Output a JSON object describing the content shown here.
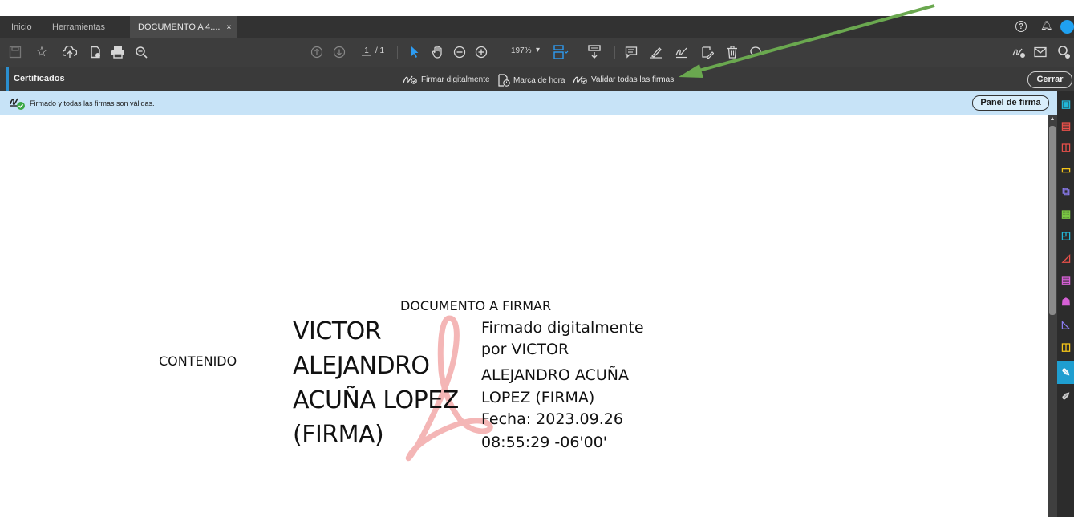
{
  "tabs": {
    "home": "Inicio",
    "tools": "Herramientas",
    "document": "DOCUMENTO A 4....",
    "close": "×"
  },
  "toolbar": {
    "page_current": "1",
    "page_total": "/ 1",
    "zoom": "197%",
    "zoom_caret": "▾"
  },
  "certificates_bar": {
    "title": "Certificados",
    "sign_digitally": "Firmar digitalmente",
    "timestamp": "Marca de hora",
    "validate_all": "Validar todas las firmas",
    "close": "Cerrar"
  },
  "signature_bar": {
    "status": "Firmado y todas las firmas son válidas.",
    "panel_button": "Panel de firma"
  },
  "document": {
    "title": "DOCUMENTO A FIRMAR",
    "content": "CONTENIDO",
    "signer_name_lines": [
      "VICTOR",
      "ALEJANDRO",
      "ACUÑA LOPEZ",
      "(FIRMA)"
    ],
    "signature_detail_lines": [
      "Firmado digitalmente",
      "por VICTOR",
      "ALEJANDRO ACUÑA",
      "LOPEZ (FIRMA)",
      "Fecha: 2023.09.26",
      "08:55:29 -06'00'"
    ]
  },
  "colors": {
    "tab_bar": "#323232",
    "toolbar": "#3d3d3d",
    "certificates_bar": "#3a3a3a",
    "signature_bar": "#c7e3f7",
    "accent_blue": "#2d9cf2",
    "annotation_arrow": "#6aa84f",
    "acrobat_watermark": "#f4b6b6"
  }
}
